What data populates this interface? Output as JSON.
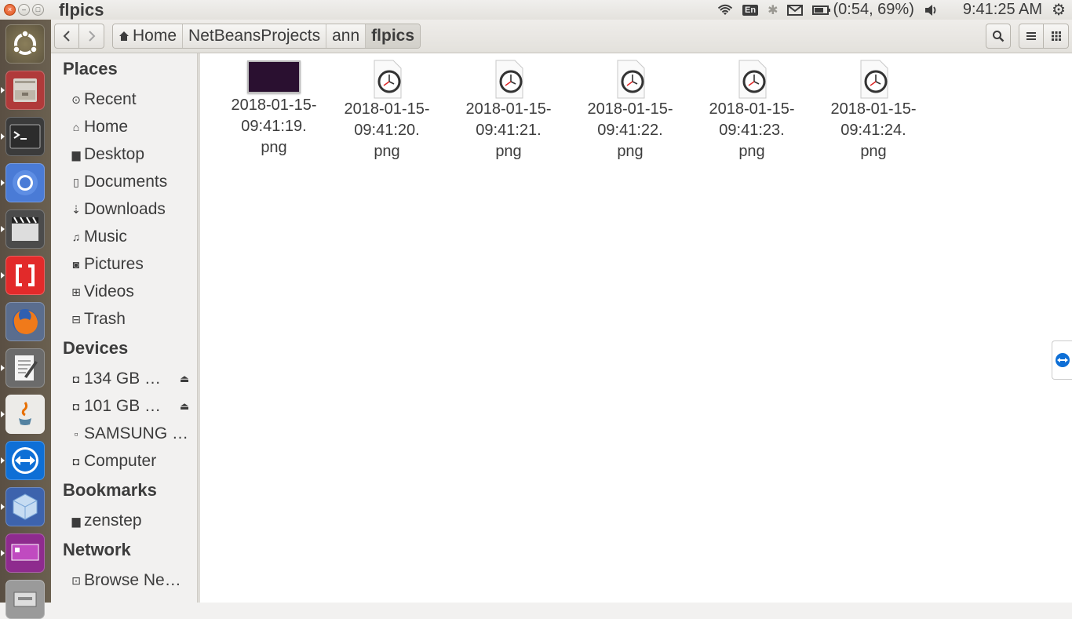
{
  "window": {
    "title": "flpics"
  },
  "indicators": {
    "keyboard": "En",
    "battery_text": "(0:54, 69%)",
    "clock": "9:41:25 AM"
  },
  "launcher": {
    "items": [
      "ubuntu-dash",
      "files",
      "terminal",
      "chromium",
      "video-editor",
      "brackets",
      "firefox",
      "text-editor",
      "java",
      "teamviewer",
      "virtualbox",
      "screen-app",
      "removable-drive"
    ]
  },
  "breadcrumbs": [
    "Home",
    "NetBeansProjects",
    "ann",
    "flpics"
  ],
  "sidebar": {
    "places_header": "Places",
    "places": [
      "Recent",
      "Home",
      "Desktop",
      "Documents",
      "Downloads",
      "Music",
      "Pictures",
      "Videos",
      "Trash"
    ],
    "devices_header": "Devices",
    "devices": [
      "134 GB …",
      "101 GB …",
      "SAMSUNG …",
      "Computer"
    ],
    "bookmarks_header": "Bookmarks",
    "bookmarks": [
      "zenstep"
    ],
    "network_header": "Network",
    "network": [
      "Browse Ne…"
    ]
  },
  "files": [
    {
      "line1": "2018-01-15-",
      "line2": "09:41:19.",
      "line3": "png",
      "kind": "thumbnail"
    },
    {
      "line1": "2018-01-15-",
      "line2": "09:41:20.",
      "line3": "png",
      "kind": "clock"
    },
    {
      "line1": "2018-01-15-",
      "line2": "09:41:21.",
      "line3": "png",
      "kind": "clock"
    },
    {
      "line1": "2018-01-15-",
      "line2": "09:41:22.",
      "line3": "png",
      "kind": "clock"
    },
    {
      "line1": "2018-01-15-",
      "line2": "09:41:23.",
      "line3": "png",
      "kind": "clock"
    },
    {
      "line1": "2018-01-15-",
      "line2": "09:41:24.",
      "line3": "png",
      "kind": "clock"
    }
  ]
}
